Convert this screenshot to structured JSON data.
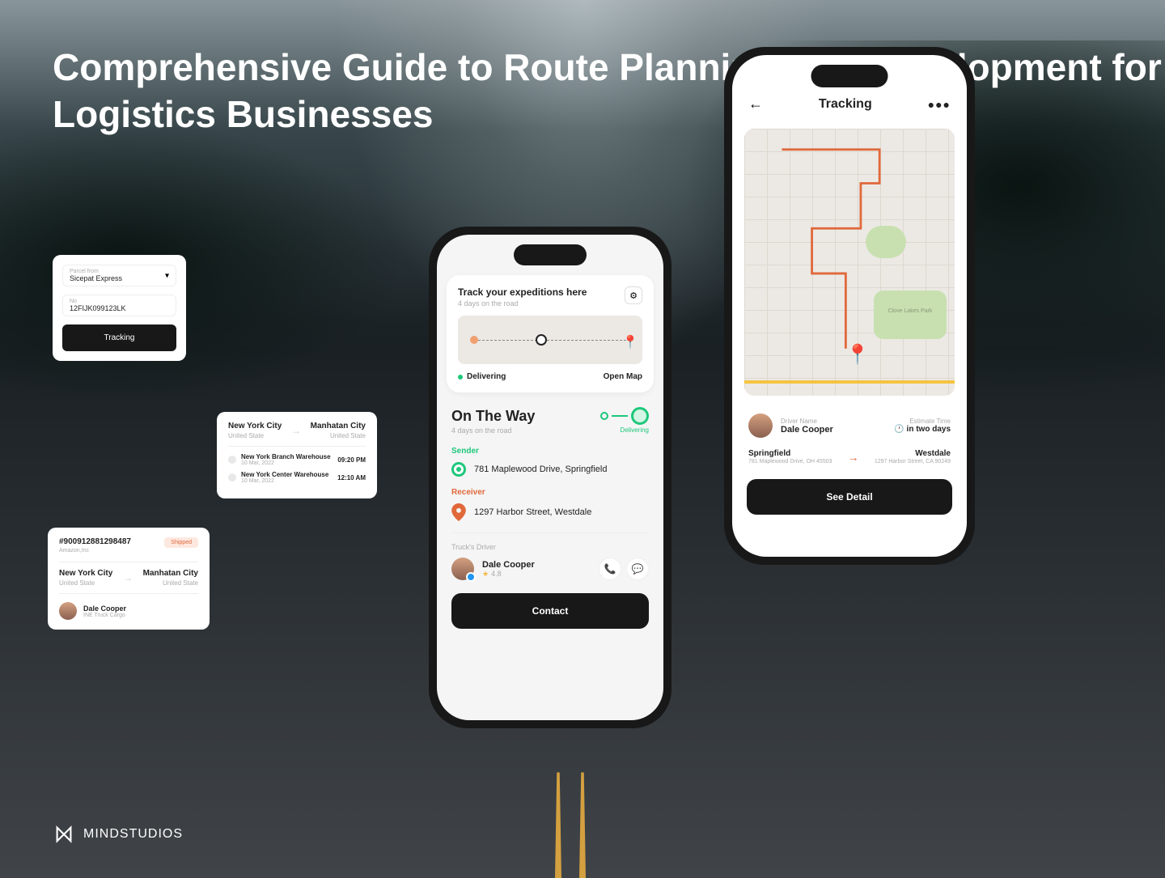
{
  "headline": "Comprehensive Guide to Route Planning App Development for Logistics Businesses",
  "tracking_form": {
    "courier_label": "Parcel from",
    "courier_value": "Sicepat Express",
    "tracking_label": "No",
    "tracking_value": "12FIJK099123LK",
    "button": "Tracking"
  },
  "route_card": {
    "from_city": "New York City",
    "from_country": "United State",
    "to_city": "Manhatan City",
    "to_country": "United State",
    "waypoints": [
      {
        "name": "New York Branch Warehouse",
        "date": "10 Mar, 2022",
        "time": "09:20 PM"
      },
      {
        "name": "New York Center Warehouse",
        "date": "10 Mar, 2022",
        "time": "12:10 AM"
      }
    ]
  },
  "shipment_card": {
    "id": "#900912881298487",
    "company": "Amazon,Inc",
    "status": "Shipped",
    "from_city": "New York City",
    "from_country": "United State",
    "to_city": "Manhatan City",
    "to_country": "United State",
    "driver_name": "Dale Cooper",
    "driver_company": "INE Truck Cargo"
  },
  "phone1": {
    "track_title": "Track your expeditions here",
    "track_sub": "4 days on the road",
    "status": "Delivering",
    "open_map": "Open Map",
    "otw_title": "On The Way",
    "otw_sub": "4 days on the road",
    "otw_status": "Delivering",
    "sender_label": "Sender",
    "sender_addr": "781 Maplewood Drive, Springfield",
    "receiver_label": "Receiver",
    "receiver_addr": "1297 Harbor Street, Westdale",
    "driver_label": "Truck's Driver",
    "driver_name": "Dale Cooper",
    "driver_rating": "4.8",
    "contact_btn": "Contact"
  },
  "phone2": {
    "title": "Tracking",
    "park_label": "Clove Lakes Park",
    "driver_label": "Driver Name",
    "driver_name": "Dale Cooper",
    "est_label": "Estimate Time",
    "est_value": "in two days",
    "from_city": "Springfield",
    "from_addr": "781 Maplewood Drive, OH 45503",
    "to_city": "Westdale",
    "to_addr": "1297 Harbor Street, CA 90249",
    "detail_btn": "See Detail"
  },
  "logo": {
    "name": "MIND",
    "suffix": "STUDIOS"
  }
}
